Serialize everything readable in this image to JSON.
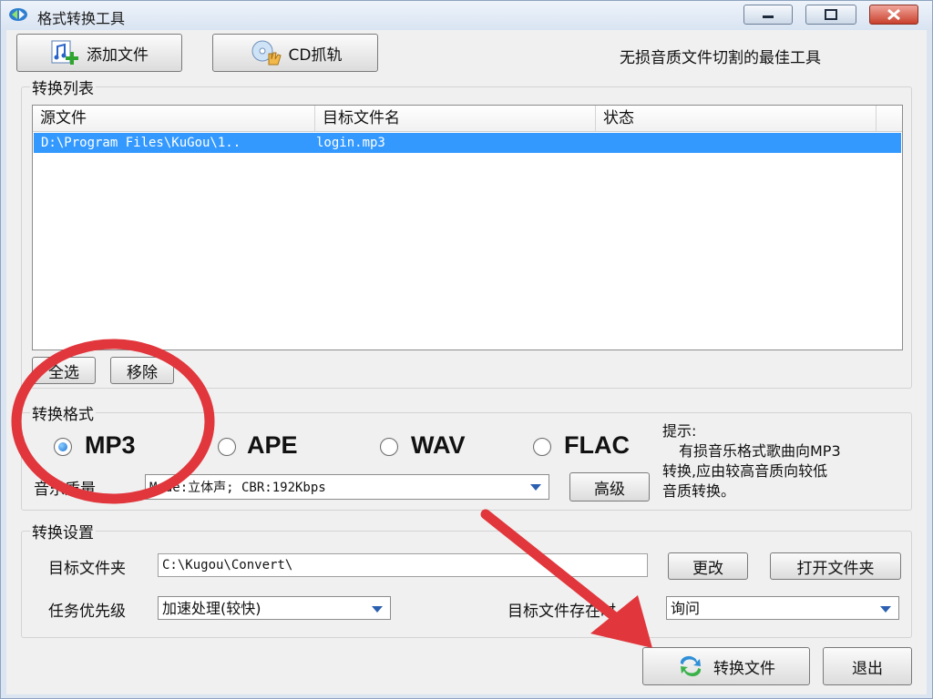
{
  "window": {
    "title": "格式转换工具"
  },
  "toolbar": {
    "add_file_label": "添加文件",
    "cd_rip_label": "CD抓轨",
    "slogan": "无损音质文件切割的最佳工具"
  },
  "convert_list": {
    "legend": "转换列表",
    "columns": [
      "源文件",
      "目标文件名",
      "状态"
    ],
    "rows": [
      {
        "source": "D:\\Program Files\\KuGou\\1..",
        "target": "login.mp3",
        "status": ""
      }
    ],
    "select_all_label": "全选",
    "remove_label": "移除"
  },
  "format": {
    "legend": "转换格式",
    "options": [
      "MP3",
      "APE",
      "WAV",
      "FLAC"
    ],
    "selected": "MP3",
    "quality_label": "音乐质量",
    "quality_value": "Mode:立体声; CBR:192Kbps",
    "advanced_label": "高级",
    "hint_title": "提示:",
    "hint_line1": "有损音乐格式歌曲向MP3",
    "hint_line2": "转换,应由较高音质向较低",
    "hint_line3": "音质转换。"
  },
  "settings": {
    "legend": "转换设置",
    "target_folder_label": "目标文件夹",
    "target_folder_value": "C:\\Kugou\\Convert\\",
    "change_label": "更改",
    "open_folder_label": "打开文件夹",
    "priority_label": "任务优先级",
    "priority_value": "加速处理(较快)",
    "exists_label": "目标文件存在时",
    "exists_value": "询问"
  },
  "footer": {
    "convert_label": "转换文件",
    "exit_label": "退出"
  },
  "colors": {
    "selection": "#3399ff",
    "annotation": "#e0363c",
    "titlebar": "#d9e4f2"
  }
}
